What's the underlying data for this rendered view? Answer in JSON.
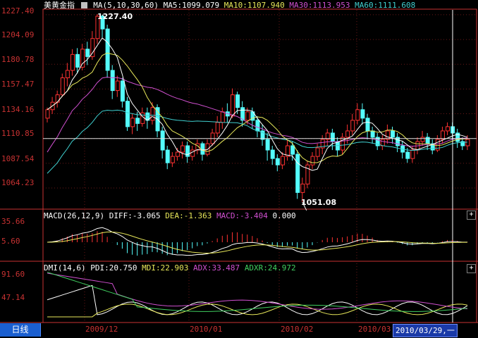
{
  "colors": {
    "up": "#54fcfc",
    "down": "#ff3232",
    "ma5": "#ffffff",
    "ma10": "#e8e85a",
    "ma30": "#d050d0",
    "ma60": "#40d0d0",
    "axis": "#c83232",
    "grid": "#6a1818"
  },
  "main": {
    "title": "美黄金指",
    "ma_label": "MA(5,10,30,60)",
    "ma5": "MA5:1099.079",
    "ma10": "MA10:1107.940",
    "ma30": "MA30:1113.953",
    "ma60": "MA60:1111.608",
    "y_ticks": [
      "1227.40",
      "1204.09",
      "1180.78",
      "1157.47",
      "1134.16",
      "1110.85",
      "1087.54",
      "1064.23"
    ],
    "high_label": "1227.40",
    "low_label": "1051.08"
  },
  "macd": {
    "params": "MACD(26,12,9)",
    "diff": "DIFF:-3.065",
    "dea": "DEA:-1.363",
    "macd": "MACD:-3.404",
    "zero": "0.000",
    "y_ticks": [
      "35.66",
      "5.60"
    ]
  },
  "dmi": {
    "params": "DMI(14,6)",
    "pdi": "PDI:20.750",
    "mdi": "MDI:22.903",
    "adx": "ADX:33.487",
    "adxr": "ADXR:24.972",
    "y_ticks": [
      "91.60",
      "47.14"
    ]
  },
  "footer": {
    "period": "日线",
    "dates": [
      "2009/12",
      "2010/01",
      "2010/02",
      "2010/03"
    ],
    "cursor_date": "2010/03/29,一"
  },
  "chart_data": {
    "type": "candlestick",
    "title": "美黄金指",
    "ylim": [
      1045,
      1232
    ],
    "horizontal_line": 1110.85,
    "candles": [
      [
        1130,
        1138,
        1126,
        1140
      ],
      [
        1138,
        1145,
        1134,
        1150
      ],
      [
        1145,
        1152,
        1140,
        1156
      ],
      [
        1152,
        1168,
        1150,
        1172
      ],
      [
        1168,
        1175,
        1160,
        1182
      ],
      [
        1175,
        1190,
        1170,
        1195
      ],
      [
        1190,
        1178,
        1172,
        1196
      ],
      [
        1178,
        1195,
        1175,
        1200
      ],
      [
        1195,
        1188,
        1180,
        1202
      ],
      [
        1188,
        1205,
        1185,
        1212
      ],
      [
        1205,
        1226,
        1200,
        1228
      ],
      [
        1226,
        1214,
        1206,
        1227.4
      ],
      [
        1214,
        1175,
        1168,
        1218
      ],
      [
        1175,
        1156,
        1148,
        1180
      ],
      [
        1156,
        1165,
        1150,
        1170
      ],
      [
        1165,
        1146,
        1140,
        1168
      ],
      [
        1146,
        1122,
        1118,
        1150
      ],
      [
        1122,
        1130,
        1115,
        1134
      ],
      [
        1130,
        1125,
        1118,
        1136
      ],
      [
        1125,
        1135,
        1122,
        1140
      ],
      [
        1135,
        1128,
        1120,
        1140
      ],
      [
        1128,
        1140,
        1124,
        1145
      ],
      [
        1140,
        1118,
        1112,
        1143
      ],
      [
        1118,
        1100,
        1092,
        1122
      ],
      [
        1100,
        1088,
        1082,
        1104
      ],
      [
        1088,
        1094,
        1084,
        1098
      ],
      [
        1094,
        1098,
        1090,
        1102
      ],
      [
        1098,
        1104,
        1092,
        1108
      ],
      [
        1104,
        1094,
        1088,
        1108
      ],
      [
        1094,
        1100,
        1090,
        1104
      ],
      [
        1100,
        1106,
        1096,
        1110
      ],
      [
        1106,
        1096,
        1090,
        1108
      ],
      [
        1096,
        1106,
        1094,
        1110
      ],
      [
        1106,
        1116,
        1104,
        1120
      ],
      [
        1116,
        1126,
        1112,
        1132
      ],
      [
        1126,
        1136,
        1120,
        1140
      ],
      [
        1136,
        1132,
        1126,
        1144
      ],
      [
        1132,
        1152,
        1130,
        1158
      ],
      [
        1152,
        1140,
        1134,
        1155
      ],
      [
        1140,
        1128,
        1122,
        1146
      ],
      [
        1128,
        1136,
        1124,
        1140
      ],
      [
        1136,
        1128,
        1120,
        1140
      ],
      [
        1128,
        1118,
        1112,
        1132
      ],
      [
        1118,
        1110,
        1104,
        1124
      ],
      [
        1110,
        1100,
        1090,
        1116
      ],
      [
        1100,
        1092,
        1086,
        1104
      ],
      [
        1092,
        1086,
        1080,
        1096
      ],
      [
        1086,
        1094,
        1082,
        1098
      ],
      [
        1094,
        1104,
        1090,
        1110
      ],
      [
        1104,
        1096,
        1090,
        1108
      ],
      [
        1096,
        1060,
        1054,
        1100
      ],
      [
        1060,
        1068,
        1051.08,
        1074
      ],
      [
        1068,
        1086,
        1064,
        1090
      ],
      [
        1086,
        1094,
        1082,
        1098
      ],
      [
        1094,
        1102,
        1090,
        1106
      ],
      [
        1102,
        1110,
        1096,
        1114
      ],
      [
        1110,
        1116,
        1104,
        1120
      ],
      [
        1116,
        1108,
        1100,
        1120
      ],
      [
        1108,
        1100,
        1094,
        1112
      ],
      [
        1100,
        1112,
        1096,
        1116
      ],
      [
        1112,
        1118,
        1106,
        1124
      ],
      [
        1118,
        1128,
        1114,
        1134
      ],
      [
        1128,
        1138,
        1124,
        1144
      ],
      [
        1138,
        1130,
        1124,
        1144
      ],
      [
        1130,
        1118,
        1110,
        1134
      ],
      [
        1118,
        1112,
        1106,
        1122
      ],
      [
        1112,
        1104,
        1100,
        1116
      ],
      [
        1104,
        1110,
        1100,
        1114
      ],
      [
        1110,
        1118,
        1106,
        1124
      ],
      [
        1118,
        1112,
        1106,
        1122
      ],
      [
        1112,
        1104,
        1098,
        1116
      ],
      [
        1104,
        1098,
        1092,
        1108
      ],
      [
        1098,
        1092,
        1088,
        1102
      ],
      [
        1092,
        1100,
        1088,
        1104
      ],
      [
        1100,
        1108,
        1096,
        1112
      ],
      [
        1108,
        1112,
        1104,
        1118
      ],
      [
        1112,
        1106,
        1100,
        1116
      ],
      [
        1106,
        1100,
        1096,
        1110
      ],
      [
        1100,
        1110,
        1098,
        1114
      ],
      [
        1110,
        1118,
        1106,
        1122
      ],
      [
        1118,
        1122,
        1114,
        1126
      ],
      [
        1122,
        1116,
        1110,
        1126
      ],
      [
        1116,
        1108,
        1102,
        1120
      ],
      [
        1108,
        1104,
        1100,
        1112
      ],
      [
        1104,
        1110,
        1100,
        1114
      ]
    ]
  }
}
